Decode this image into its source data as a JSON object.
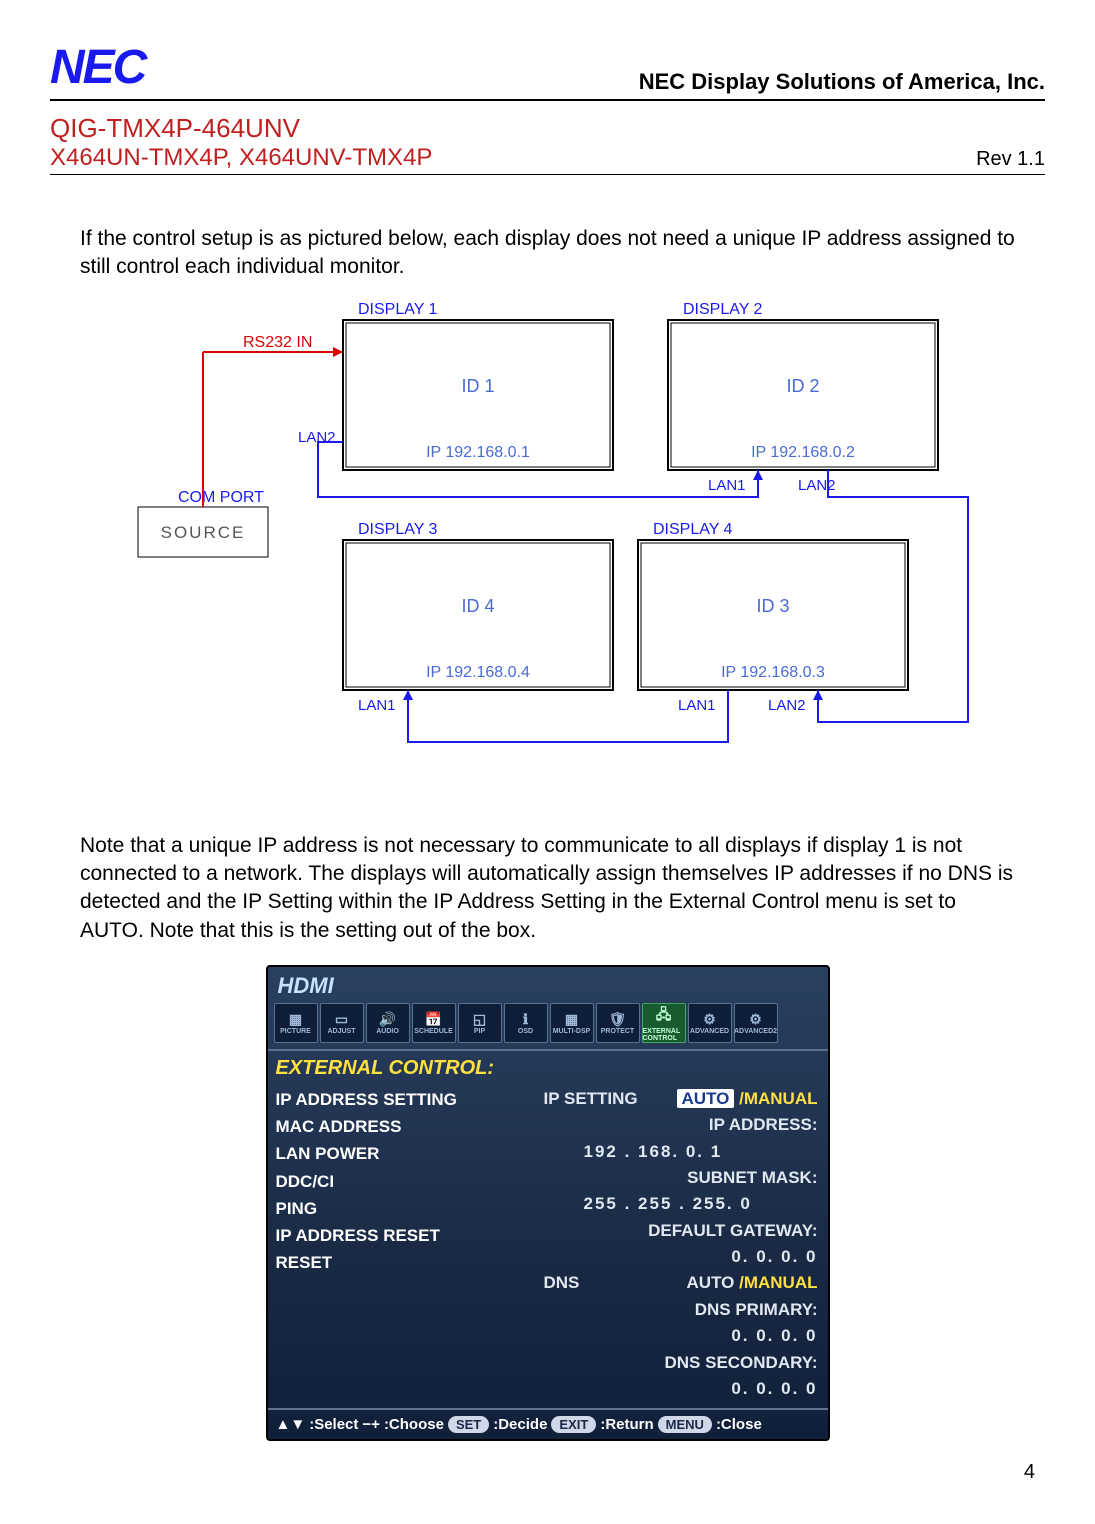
{
  "header": {
    "logo_text": "NEC",
    "company": "NEC Display Solutions of America, Inc.",
    "doc_title": "QIG-TMX4P-464UNV",
    "doc_subtitle": "X464UN-TMX4P, X464UNV-TMX4P",
    "revision": "Rev 1.1"
  },
  "paragraphs": {
    "p1": "If the control setup is as pictured below, each display does not need a unique IP address assigned to still control each individual monitor.",
    "p2": "Note that a unique IP address is not necessary to communicate to all displays if display 1 is not connected to a network.  The displays will automatically assign themselves IP addresses if no DNS is detected and the IP Setting within the IP Address Setting in the External Control menu is set to AUTO.  Note that this is the setting out of the box."
  },
  "diagram": {
    "source_label_top": "COM PORT",
    "source_label": "SOURCE",
    "rs232_label": "RS232 IN",
    "displays": [
      {
        "title": "DISPLAY 1",
        "id": "ID 1",
        "ip": "IP 192.168.0.1"
      },
      {
        "title": "DISPLAY 2",
        "id": "ID 2",
        "ip": "IP 192.168.0.2"
      },
      {
        "title": "DISPLAY 3",
        "id": "ID 4",
        "ip": "IP 192.168.0.4"
      },
      {
        "title": "DISPLAY 4",
        "id": "ID 3",
        "ip": "IP 192.168.0.3"
      }
    ],
    "lan_labels": {
      "lan1": "LAN1",
      "lan2": "LAN2"
    }
  },
  "osd": {
    "top": "HDMI",
    "icons": [
      "PICTURE",
      "ADJUST",
      "AUDIO",
      "SCHEDULE",
      "PIP",
      "OSD",
      "MULTI-DSP",
      "PROTECT",
      "EXTERNAL CONTROL",
      "ADVANCED",
      "ADVANCED2"
    ],
    "section": "EXTERNAL CONTROL:",
    "left_menu": [
      "IP ADDRESS SETTING",
      "MAC ADDRESS",
      "LAN POWER",
      "DDC/CI",
      "PING",
      "IP ADDRESS RESET",
      "RESET"
    ],
    "right": {
      "ip_setting_label": "IP SETTING",
      "ip_setting_auto": "AUTO",
      "ip_setting_manual": "MANUAL",
      "ip_address_label": "IP ADDRESS:",
      "ip_address_value": "192 . 168.    0.    1",
      "subnet_label": "SUBNET MASK:",
      "subnet_value": "255 . 255 . 255.    0",
      "gateway_label": "DEFAULT GATEWAY:",
      "gateway_value": "0.    0.    0.    0",
      "dns_label": "DNS",
      "dns_auto": "AUTO",
      "dns_manual": "MANUAL",
      "dns_primary_label": "DNS PRIMARY:",
      "dns_primary_value": "0.    0.    0.    0",
      "dns_secondary_label": "DNS SECONDARY:",
      "dns_secondary_value": "0.    0.    0.    0"
    },
    "footer": {
      "select": ":Select",
      "choose": ":Choose",
      "decide": ":Decide",
      "return": ":Return",
      "close": ":Close",
      "btn_set": "SET",
      "btn_exit": "EXIT",
      "btn_menu": "MENU"
    }
  },
  "page_number": "4"
}
